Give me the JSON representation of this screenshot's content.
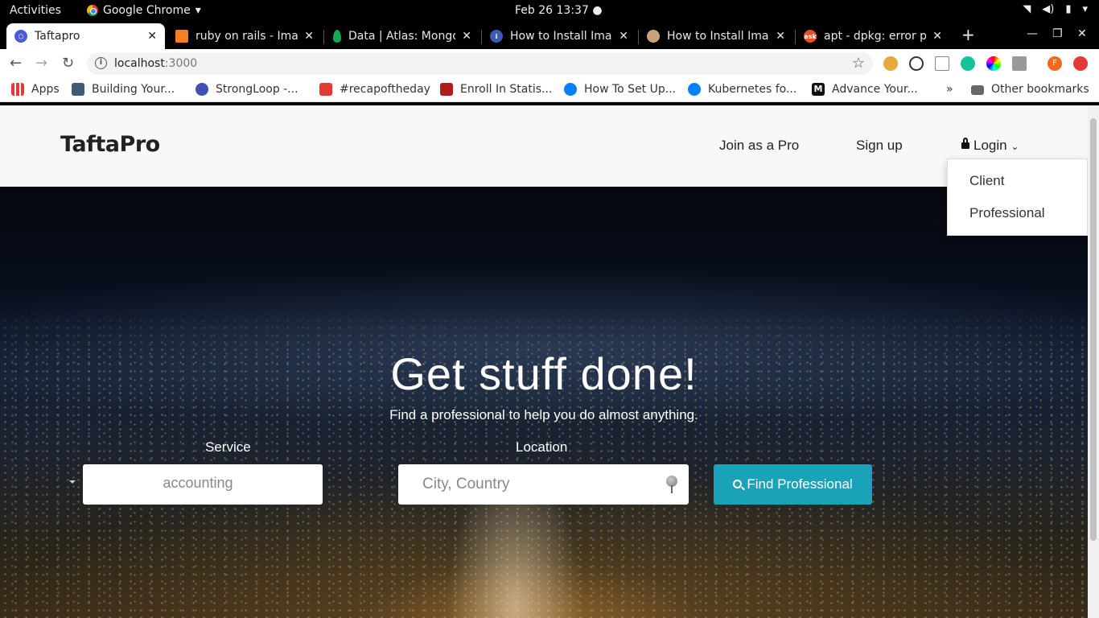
{
  "system_bar": {
    "activities": "Activities",
    "app_name": "Google Chrome",
    "clock": "Feb 26  13:37"
  },
  "tabs": [
    {
      "title": "Taftapro",
      "active": true
    },
    {
      "title": "ruby on rails - Image",
      "active": false
    },
    {
      "title": "Data | Atlas: MongoDB",
      "active": false
    },
    {
      "title": "How to Install Imag",
      "active": false
    },
    {
      "title": "How to Install Imag",
      "active": false
    },
    {
      "title": "apt - dpkg: error pro",
      "active": false
    }
  ],
  "address_bar": {
    "host": "localhost",
    "port": ":3000"
  },
  "bookmarks": [
    {
      "label": "Apps",
      "icon": "apps-grid-icon"
    },
    {
      "label": "Building Your...",
      "icon": "building-icon"
    },
    {
      "label": "StrongLoop -...",
      "icon": "strongloop-icon"
    },
    {
      "label": "#recapoftheday",
      "icon": "calendar-icon"
    },
    {
      "label": "Enroll In Statis...",
      "icon": "edx-icon"
    },
    {
      "label": "How To Set Up...",
      "icon": "digitalocean-icon"
    },
    {
      "label": "Kubernetes fo...",
      "icon": "digitalocean-icon"
    },
    {
      "label": "Advance Your...",
      "icon": "medium-icon"
    }
  ],
  "bookmarks_overflow": "»",
  "other_bookmarks": "Other bookmarks",
  "site": {
    "logo": "TaftaPro",
    "nav": {
      "join": "Join as a Pro",
      "signup": "Sign up",
      "login": "Login"
    },
    "login_menu": [
      "Client",
      "Professional"
    ],
    "hero": {
      "title": "Get stuff done!",
      "subtitle": "Find a professional to help you do almost anything.",
      "service_label": "Service",
      "service_value": "accounting",
      "location_label": "Location",
      "location_placeholder": "City, Country",
      "find_button": "Find Professional"
    }
  },
  "colors": {
    "find_button": "#1aa3b8",
    "nav_bg": "#f8f8f8"
  }
}
